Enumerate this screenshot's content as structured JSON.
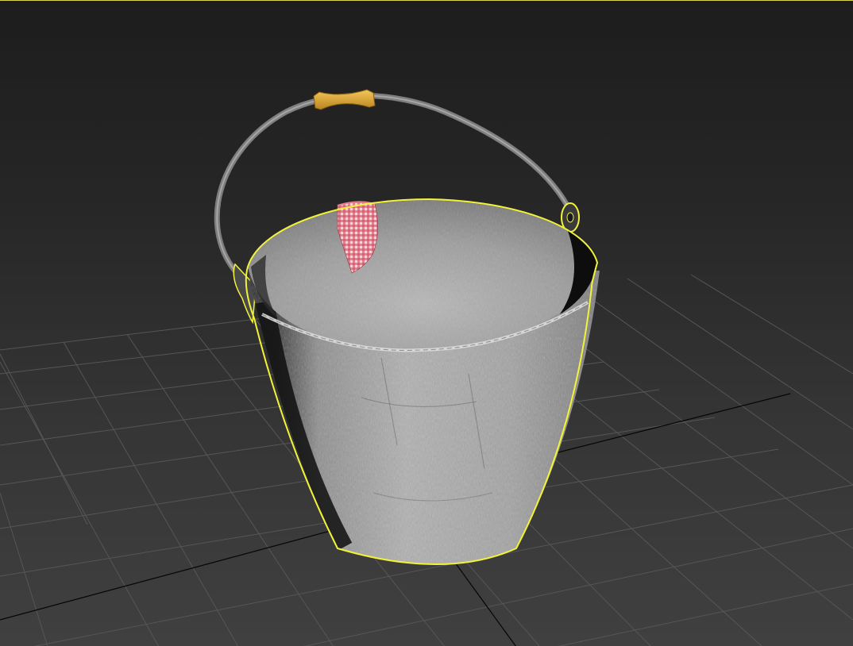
{
  "viewport": {
    "view": "perspective",
    "shading": "textured",
    "grid": true,
    "background_top": "#1d1d1d",
    "background_bottom": "#404040",
    "grid_color": "#5a5a5a",
    "axis_line_color": "#050505"
  },
  "scene": {
    "objects": [
      {
        "name": "bucket",
        "selected": true,
        "selection_color": "#f2f23a",
        "material_color": "#a9a9a9"
      },
      {
        "name": "handle",
        "selected": false,
        "material_color": "#8c8c8c"
      },
      {
        "name": "handle-grip",
        "selected": false,
        "material_color": "#e0ac3c"
      },
      {
        "name": "cloth",
        "selected": false,
        "material_color": "#d44a5e",
        "pattern": "gingham"
      }
    ]
  }
}
